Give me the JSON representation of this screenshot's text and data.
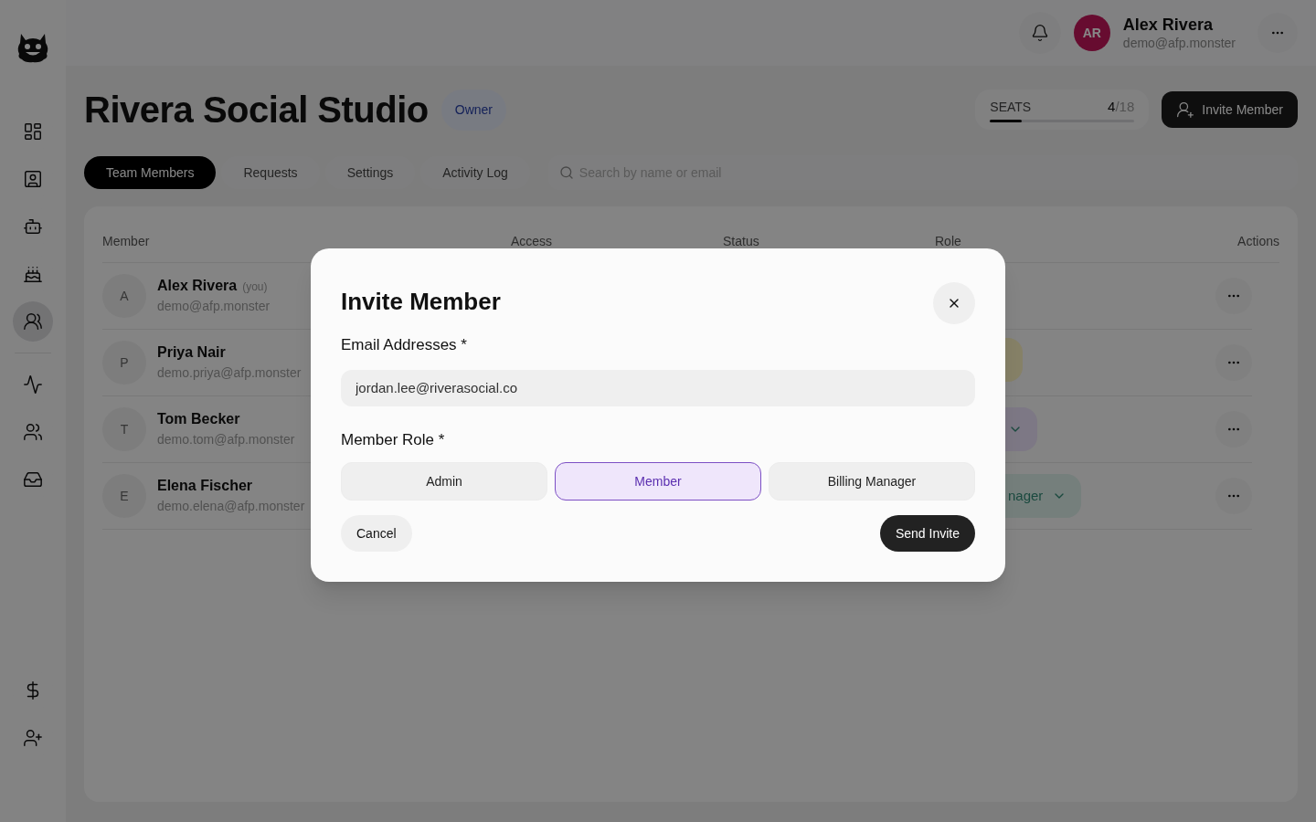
{
  "sidebar": {
    "top_items": [
      {
        "selected": false
      },
      {
        "selected": false
      },
      {
        "selected": false
      },
      {
        "selected": false
      },
      {
        "selected": true
      }
    ],
    "mid_items": [
      {
        "selected": false
      },
      {
        "selected": false
      },
      {
        "selected": false
      }
    ],
    "bottom_items": [
      {
        "selected": false
      },
      {
        "selected": false
      }
    ]
  },
  "header": {
    "avatar_initials": "AR",
    "user_name": "Alex Rivera",
    "user_email": "demo@afp.monster"
  },
  "page": {
    "title": "Rivera Social Studio",
    "badge": "Owner",
    "seats": {
      "label": "SEATS",
      "used": "4",
      "total": "/18",
      "level": 0.22
    },
    "invite_button": "Invite Member"
  },
  "tabs": [
    {
      "label": "Team Members",
      "selected": true
    },
    {
      "label": "Requests",
      "selected": false
    },
    {
      "label": "Settings",
      "selected": false
    },
    {
      "label": "Activity Log",
      "selected": false
    }
  ],
  "search": {
    "placeholder": "Search by name or email"
  },
  "table": {
    "columns": [
      "Member",
      "Access",
      "Status",
      "Role",
      "Actions"
    ],
    "rows": [
      {
        "initial": "A",
        "name": "Alex Rivera",
        "tag": "(you)",
        "email": "demo@afp.monster"
      },
      {
        "initial": "P",
        "name": "Priya Nair",
        "email": "demo.priya@afp.monster",
        "role": {
          "color": "#868167"
        }
      },
      {
        "initial": "T",
        "name": "Tom Becker",
        "email": "demo.tom@afp.monster",
        "role": {
          "color": "#7d7885",
          "chevron": true
        }
      },
      {
        "initial": "E",
        "name": "Elena Fischer",
        "email": "demo.elena@afp.monster",
        "role": {
          "color": "#757f7c",
          "text": "nager",
          "chevron": true
        }
      }
    ]
  },
  "dialog": {
    "title": "Invite Member",
    "email_label": "Email Addresses *",
    "email_value": "jordan.lee@riverasocial.co",
    "role_label": "Member Role *",
    "roles": [
      {
        "label": "Admin",
        "selected": false
      },
      {
        "label": "Member",
        "selected": true
      },
      {
        "label": "Billing Manager",
        "selected": false
      }
    ],
    "cancel": "Cancel",
    "submit": "Send Invite"
  }
}
